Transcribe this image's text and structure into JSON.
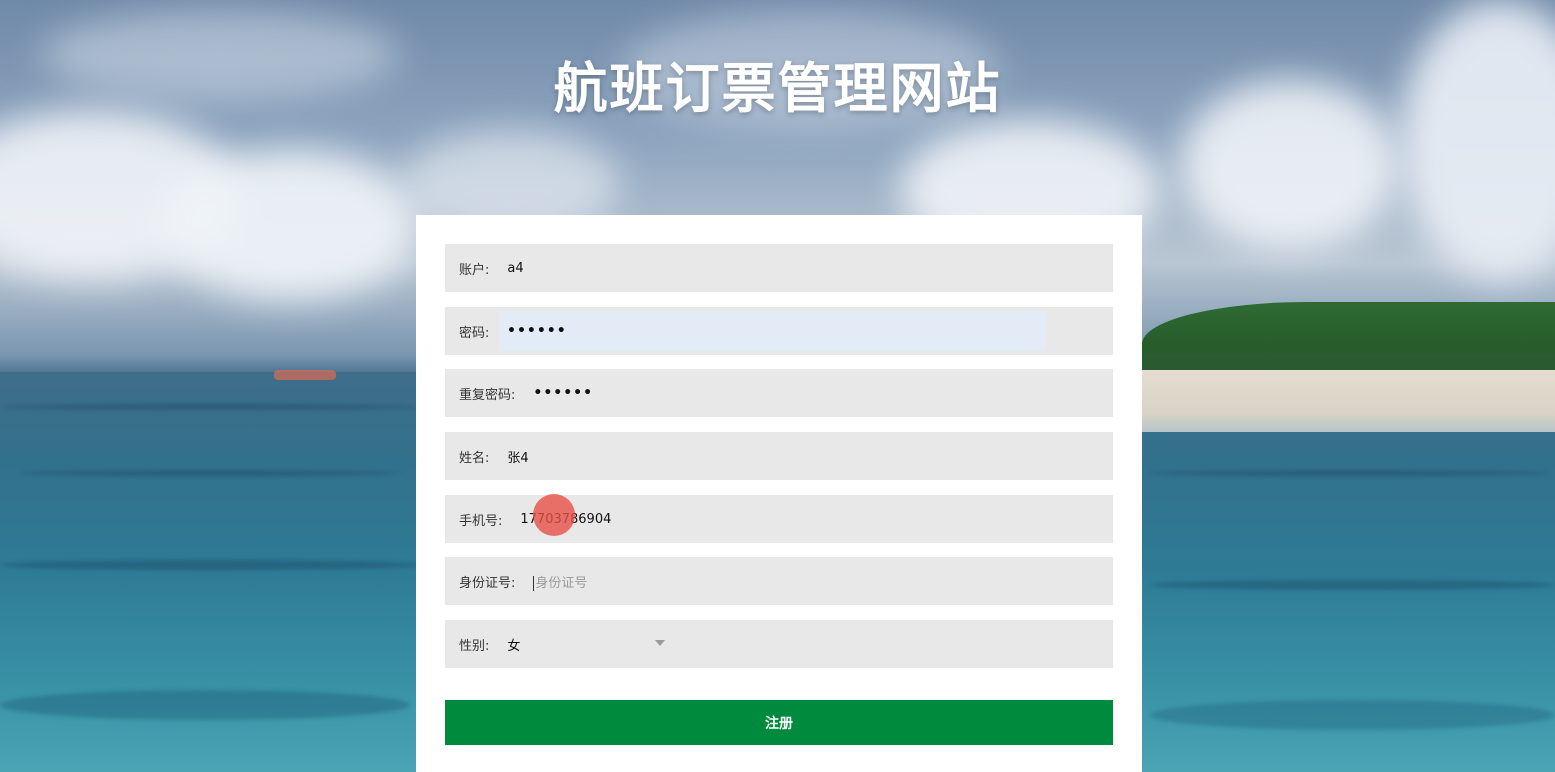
{
  "page": {
    "title": "航班订票管理网站"
  },
  "form": {
    "account": {
      "label": "账户:",
      "value": "a4"
    },
    "password": {
      "label": "密码:",
      "value": "••••••"
    },
    "confirm_password": {
      "label": "重复密码:",
      "value": "••••••"
    },
    "name": {
      "label": "姓名:",
      "value": "张4"
    },
    "phone": {
      "label": "手机号:",
      "value": "17703786904"
    },
    "id_card": {
      "label": "身份证号:",
      "value": "",
      "placeholder": "身份证号"
    },
    "gender": {
      "label": "性别:",
      "value": "女"
    },
    "submit_label": "注册"
  },
  "colors": {
    "submit_button": "#008a3d",
    "field_background": "#e8e8e8",
    "focused_field": "#e2ebf6"
  }
}
